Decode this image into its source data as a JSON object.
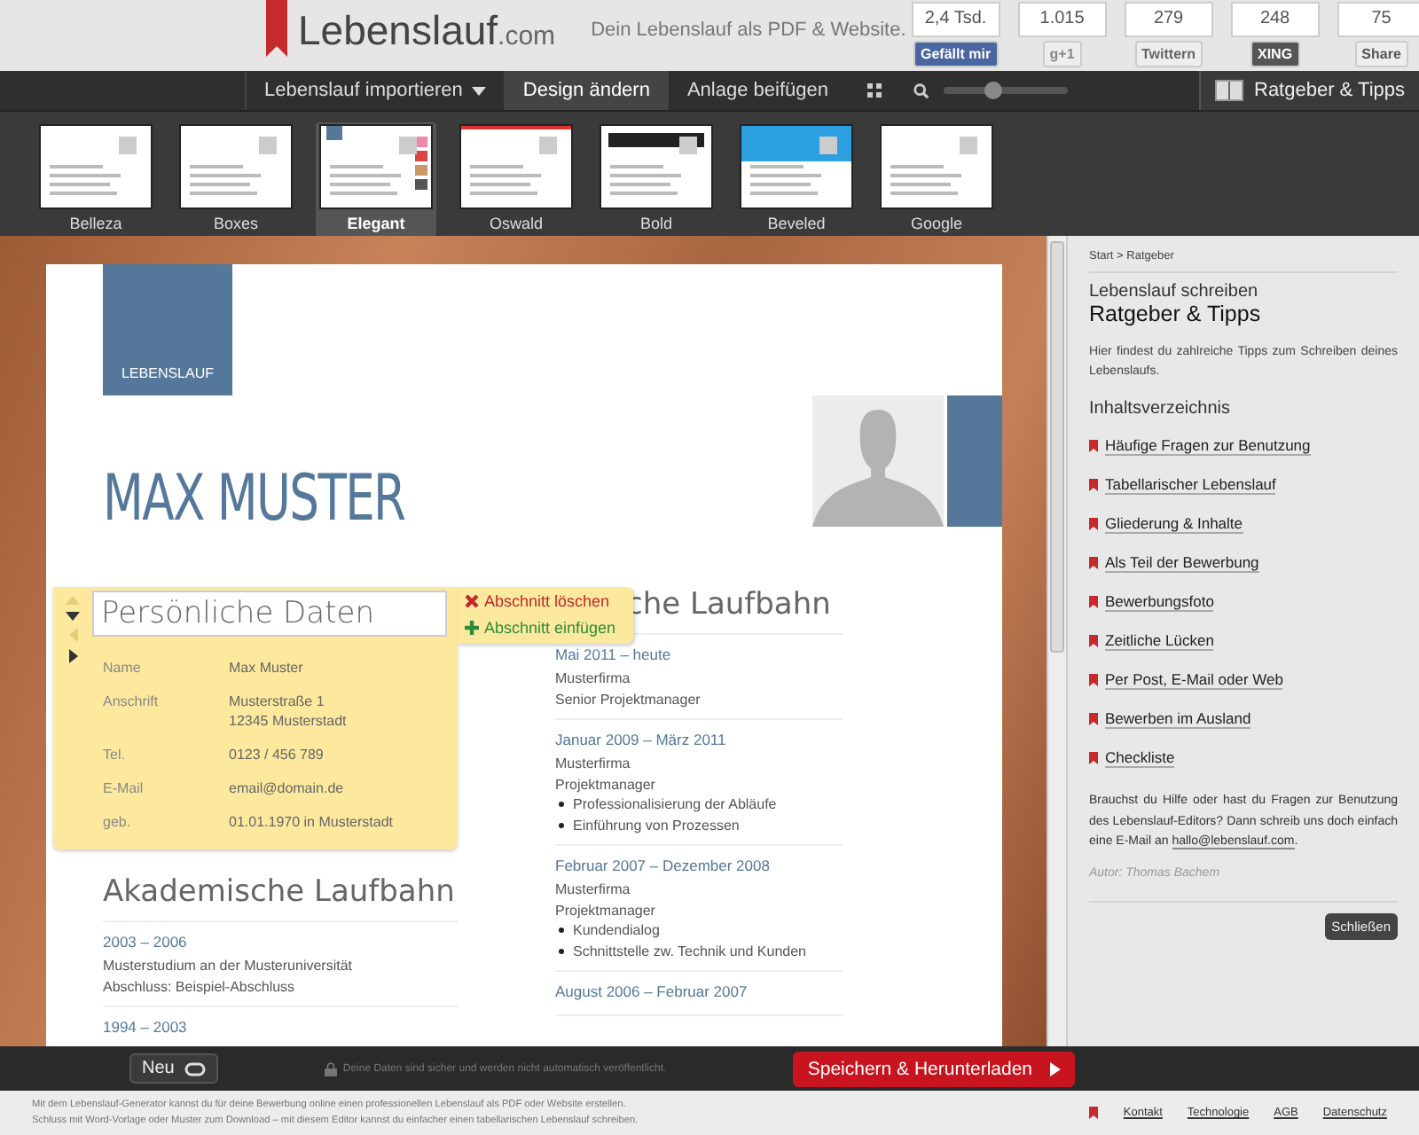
{
  "header": {
    "logo_main": "Lebenslauf",
    "logo_suffix": ".com",
    "tagline": "Dein Lebenslauf als PDF & Website.",
    "social": [
      {
        "count": "2,4 Tsd.",
        "label": "Gefällt mir",
        "kind": "facebook"
      },
      {
        "count": "1.015",
        "label": "g+1",
        "kind": "google"
      },
      {
        "count": "279",
        "label": "Twittern",
        "kind": "twitter"
      },
      {
        "count": "248",
        "label": "XING",
        "kind": "xing"
      },
      {
        "count": "75",
        "label": "Share",
        "kind": "linkedin"
      }
    ]
  },
  "toolbar": {
    "items": [
      {
        "label": "Lebenslauf importieren",
        "kind": "dropdown",
        "selected": false
      },
      {
        "label": "Design ändern",
        "kind": "tab",
        "selected": true
      },
      {
        "label": "Anlage beifügen",
        "kind": "tab",
        "selected": false
      }
    ],
    "zoom": {
      "level": 0.4
    },
    "guide_button": "Ratgeber & Tipps"
  },
  "templates": [
    {
      "name": "Belleza",
      "selected": false
    },
    {
      "name": "Boxes",
      "selected": false
    },
    {
      "name": "Elegant",
      "selected": true
    },
    {
      "name": "Oswald",
      "selected": false
    },
    {
      "name": "Bold",
      "selected": false
    },
    {
      "name": "Beveled",
      "selected": false
    },
    {
      "name": "Google",
      "selected": false
    }
  ],
  "resume": {
    "badge": "LEBENSLAUF",
    "name": "MAX MUSTER",
    "personal": {
      "title": "Persönliche Daten",
      "actions": [
        {
          "label": "Abschnitt löschen",
          "kind": "delete"
        },
        {
          "label": "Abschnitt einfügen",
          "kind": "insert"
        }
      ],
      "rows": [
        {
          "label": "Name",
          "value": [
            "Max Muster"
          ]
        },
        {
          "label": "Anschrift",
          "value": [
            "Musterstraße 1",
            "12345 Musterstadt"
          ]
        },
        {
          "label": "Tel.",
          "value": [
            "0123 / 456 789"
          ]
        },
        {
          "label": "E-Mail",
          "value": [
            "email@domain.de"
          ]
        },
        {
          "label": "geb.",
          "value": [
            "01.01.1970 in Musterstadt"
          ]
        }
      ]
    },
    "academic": {
      "title": "Akademische Laufbahn",
      "entries": [
        {
          "date": "2003 – 2006",
          "lines": [
            "Musterstudium an der Musteruniversität",
            "Abschluss: Beispiel-Abschluss"
          ]
        },
        {
          "date": "1994 – 2003"
        }
      ]
    },
    "career": {
      "title": "che Laufbahn",
      "entries": [
        {
          "date": "Mai 2011 – heute",
          "lines": [
            "Musterfirma",
            "Senior Projektmanager"
          ]
        },
        {
          "date": "Januar 2009 – März 2011",
          "lines": [
            "Musterfirma",
            "Projektmanager"
          ],
          "bullets": [
            "Professionalisierung der Abläufe",
            "Einführung von Prozessen"
          ]
        },
        {
          "date": "Februar 2007 – Dezember 2008",
          "lines": [
            "Musterfirma",
            "Projektmanager"
          ],
          "bullets": [
            "Kundendialog",
            "Schnittstelle zw. Technik und Kunden"
          ]
        },
        {
          "date": "August 2006 – Februar 2007"
        }
      ]
    }
  },
  "sidebar": {
    "breadcrumb": "Start > Ratgeber",
    "subtitle": "Lebenslauf schreiben",
    "title": "Ratgeber & Tipps",
    "intro": "Hier findest du zahlreiche Tipps zum Schreiben deines Lebenslaufs.",
    "toc_title": "Inhaltsverzeichnis",
    "links": [
      "Häufige Fragen zur Benutzung",
      "Tabellarischer Lebenslauf",
      "Gliederung & Inhalte",
      "Als Teil der Bewerbung",
      "Bewerbungsfoto",
      "Zeitliche Lücken",
      "Per Post, E-Mail oder Web",
      "Bewerben im Ausland",
      "Checkliste"
    ],
    "help_text": "Brauchst du Hilfe oder hast du Fragen zur Benutzung des Lebenslauf-Editors? Dann schreib uns doch einfach eine E-Mail an",
    "help_email": "hallo@lebenslauf.com",
    "help_end": ".",
    "author": "Autor: Thomas Bachem",
    "close_button": "Schließen"
  },
  "bottom_bar": {
    "new_button": "Neu",
    "notice": "Deine Daten sind sicher und werden nicht automatisch veröffentlicht.",
    "save_button": "Speichern & Herunterladen"
  },
  "footer": {
    "lines": [
      "Mit dem Lebenslauf-Generator kannst du für deine Bewerbung online einen professionellen Lebenslauf als PDF oder Website erstellen.",
      "Schluss mit Word-Vorlage oder Muster zum Download – mit diesem Editor kannst du einfacher einen tabellarischen Lebenslauf schreiben."
    ],
    "links": [
      "Kontakt",
      "Technologie",
      "AGB",
      "Datenschutz"
    ]
  }
}
